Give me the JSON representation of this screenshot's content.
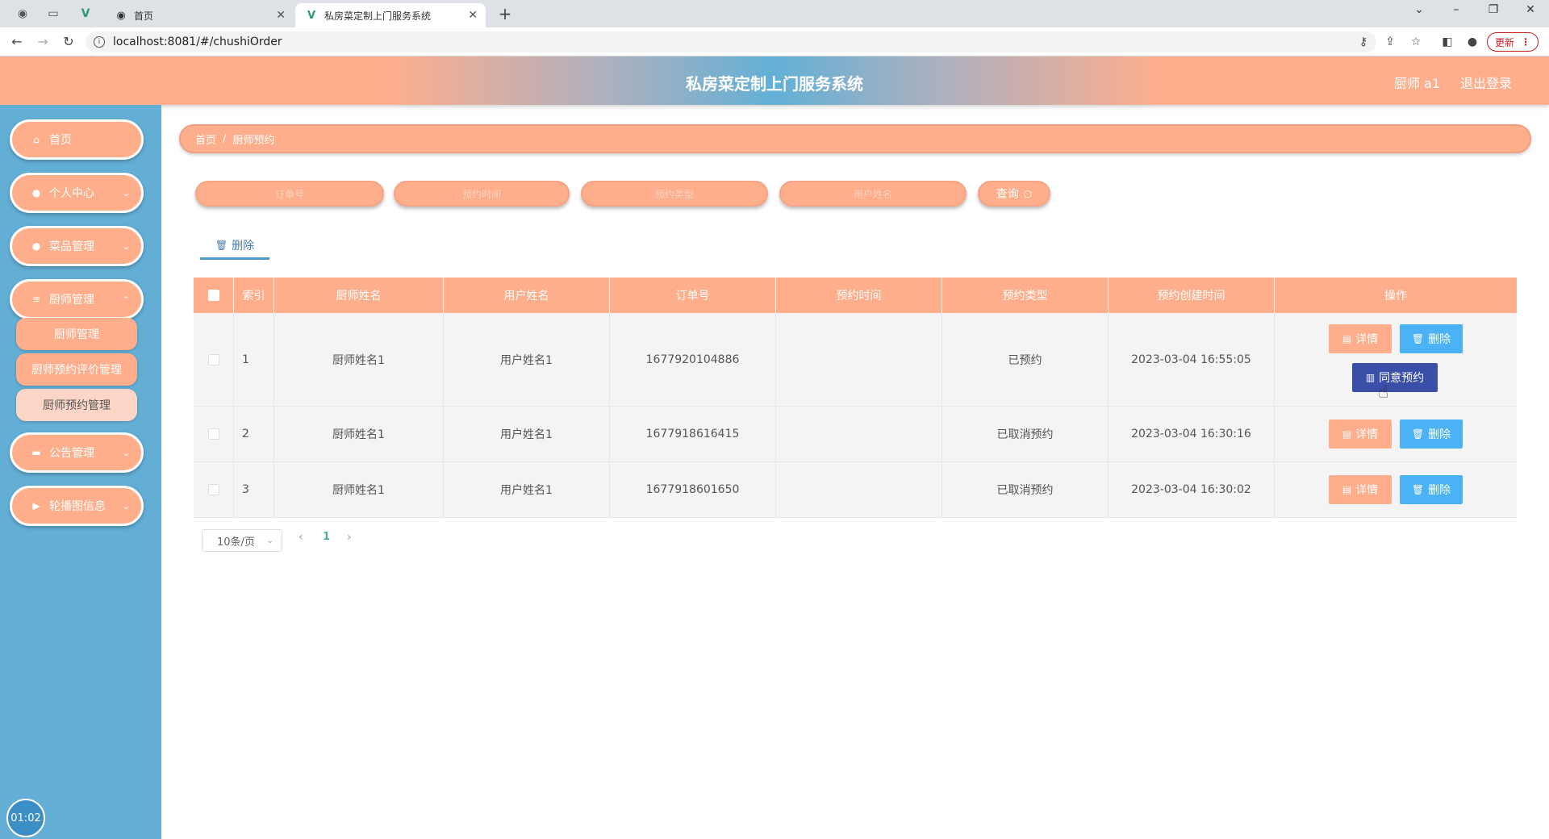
{
  "browser": {
    "tabs": [
      {
        "label": "首页"
      },
      {
        "label": "私房菜定制上门服务系统"
      }
    ],
    "url": "localhost:8081/#/chushiOrder",
    "update_label": "更新"
  },
  "header": {
    "title": "私房菜定制上门服务系统",
    "user": "厨师 a1",
    "logout": "退出登录"
  },
  "sidebar": {
    "items": [
      {
        "label": "首页",
        "icon": "home-icon"
      },
      {
        "label": "个人中心",
        "icon": "user-icon"
      },
      {
        "label": "菜品管理",
        "icon": "user-icon"
      },
      {
        "label": "厨师管理",
        "icon": "list-icon"
      },
      {
        "label": "公告管理",
        "icon": "monitor-icon"
      },
      {
        "label": "轮播图信息",
        "icon": "video-icon"
      }
    ],
    "submenu": [
      {
        "label": "厨师管理"
      },
      {
        "label": "厨师预约评价管理"
      },
      {
        "label": "厨师预约管理"
      }
    ],
    "timer": "01:02"
  },
  "breadcrumb": {
    "home": "首页",
    "separator": "/",
    "current": "厨师预约"
  },
  "search": {
    "placeholders": [
      "订单号",
      "预约时间",
      "预约类型",
      "用户姓名"
    ],
    "button": "查询"
  },
  "toolbar": {
    "delete": "删除"
  },
  "table": {
    "columns": [
      "索引",
      "厨师姓名",
      "用户姓名",
      "订单号",
      "预约时间",
      "预约类型",
      "预约创建时间",
      "操作"
    ],
    "rows": [
      {
        "index": "1",
        "chef": "厨师姓名1",
        "user": "用户姓名1",
        "order": "1677920104886",
        "time": "",
        "type": "已预约",
        "created": "2023-03-04 16:55:05"
      },
      {
        "index": "2",
        "chef": "厨师姓名1",
        "user": "用户姓名1",
        "order": "1677918616415",
        "time": "",
        "type": "已取消预约",
        "created": "2023-03-04 16:30:16"
      },
      {
        "index": "3",
        "chef": "厨师姓名1",
        "user": "用户姓名1",
        "order": "1677918601650",
        "time": "",
        "type": "已取消预约",
        "created": "2023-03-04 16:30:02"
      }
    ],
    "actions": {
      "detail": "详情",
      "delete": "删除",
      "agree": "同意预约"
    }
  },
  "pagination": {
    "page_size": "10条/页",
    "current_page": "1"
  },
  "colors": {
    "accent": "#ffae8c",
    "sidebar": "#63aed5",
    "delete_button": "#4ab2f5",
    "agree_button": "#3a4fa8"
  }
}
